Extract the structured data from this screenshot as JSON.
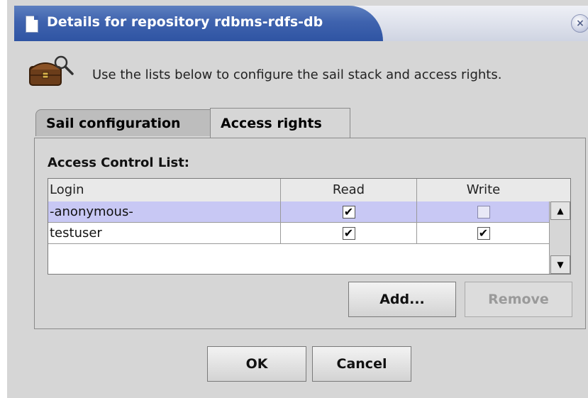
{
  "window": {
    "title": "Details for repository rdbms-rdfs-db",
    "close_glyph": "×"
  },
  "header": {
    "icon": "treasure-chest-search-icon",
    "intro": "Use the lists below to configure the sail stack and access rights."
  },
  "tabs": [
    {
      "label": "Sail configuration",
      "selected": false
    },
    {
      "label": "Access rights",
      "selected": true
    }
  ],
  "acl": {
    "label": "Access Control List:",
    "columns": [
      "Login",
      "Read",
      "Write"
    ],
    "rows": [
      {
        "login": "-anonymous-",
        "read": true,
        "write": false,
        "selected": true
      },
      {
        "login": "testuser",
        "read": true,
        "write": true,
        "selected": false
      }
    ],
    "check_glyph": "✔"
  },
  "buttons": {
    "add": "Add...",
    "remove": "Remove",
    "ok": "OK",
    "cancel": "Cancel"
  },
  "colors": {
    "titlebar": "#3f63ae",
    "selected_row": "#c8c8f4"
  }
}
